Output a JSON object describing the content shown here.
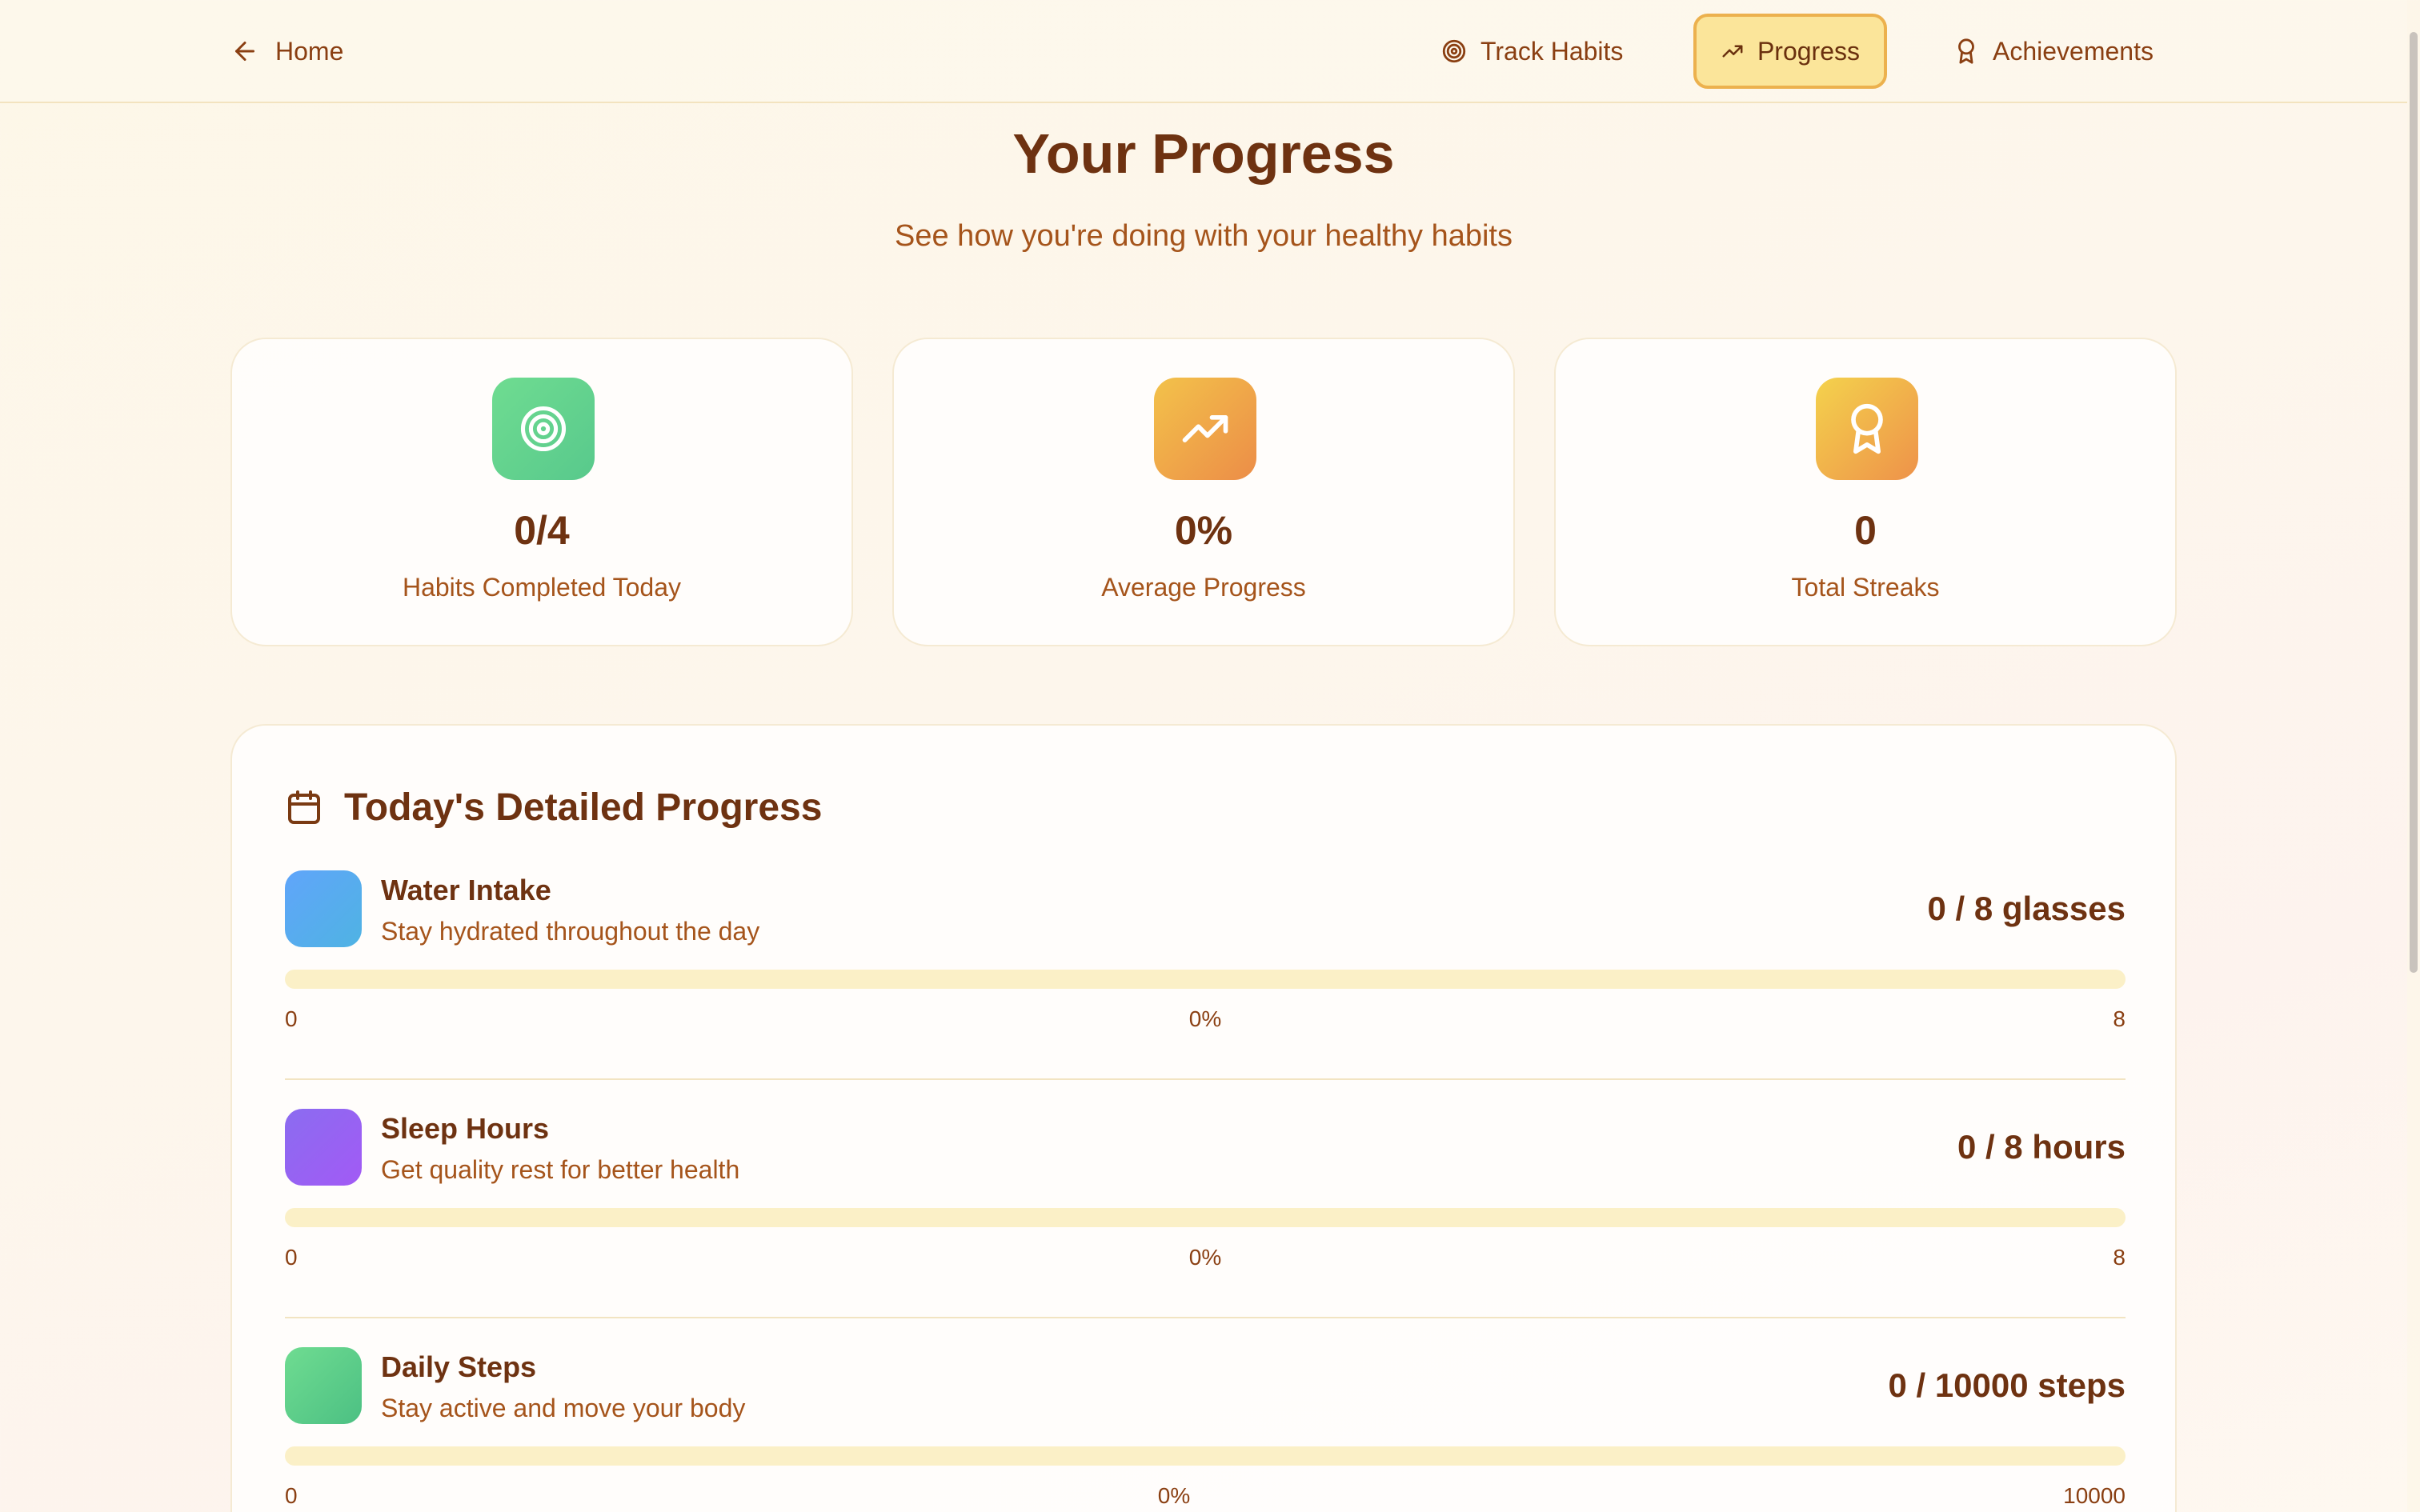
{
  "nav": {
    "home_label": "Home",
    "items": [
      {
        "label": "Track Habits",
        "icon": "target-icon",
        "active": false
      },
      {
        "label": "Progress",
        "icon": "trending-up-icon",
        "active": true
      },
      {
        "label": "Achievements",
        "icon": "award-icon",
        "active": false
      }
    ]
  },
  "header": {
    "title": "Your Progress",
    "subtitle": "See how you're doing with your healthy habits"
  },
  "stats": [
    {
      "value": "0/4",
      "label": "Habits Completed Today",
      "icon": "target-icon",
      "color": "#6fdc91"
    },
    {
      "value": "0%",
      "label": "Average Progress",
      "icon": "trending-up-icon",
      "color": "#f0a848"
    },
    {
      "value": "0",
      "label": "Total Streaks",
      "icon": "award-icon",
      "color": "#f2c04a"
    }
  ],
  "detail": {
    "title": "Today's Detailed Progress",
    "icon": "calendar-icon",
    "habits": [
      {
        "name": "Water Intake",
        "description": "Stay hydrated throughout the day",
        "value_text": "0 / 8 glasses",
        "min": "0",
        "percent_text": "0%",
        "max": "8",
        "progress": 0,
        "color": "#60a5fa"
      },
      {
        "name": "Sleep Hours",
        "description": "Get quality rest for better health",
        "value_text": "0 / 8 hours",
        "min": "0",
        "percent_text": "0%",
        "max": "8",
        "progress": 0,
        "color": "#9a62f4"
      },
      {
        "name": "Daily Steps",
        "description": "Stay active and move your body",
        "value_text": "0 / 10000 steps",
        "min": "0",
        "percent_text": "0%",
        "max": "10000",
        "progress": 0,
        "color": "#5fd08a"
      }
    ]
  }
}
